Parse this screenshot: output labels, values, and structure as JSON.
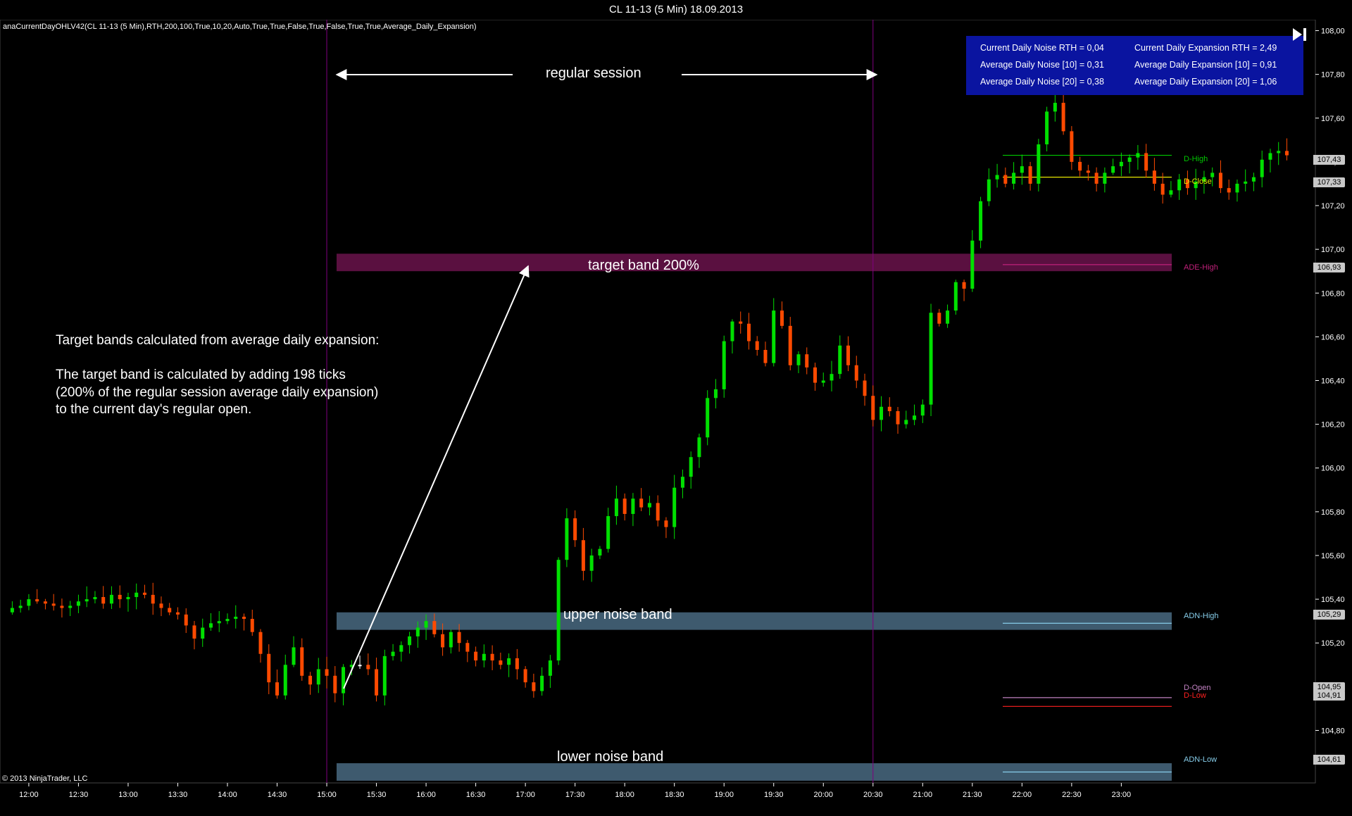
{
  "window": {
    "title": "CL 11-13 (5 Min)  18.09.2013"
  },
  "indicator_label": "anaCurrentDayOHLV42(CL 11-13 (5 Min),RTH,200,100,True,10,20,Auto,True,True,False,True,False,True,True,Average_Daily_Expansion)",
  "copyright": "© 2013 NinjaTrader, LLC",
  "info_box": {
    "current_noise": "Current Daily Noise RTH = 0,04",
    "avg_noise_10": "Average Daily Noise [10] = 0,31",
    "avg_noise_20": "Average Daily Noise [20] = 0,38",
    "current_expansion": "Current Daily Expansion RTH = 2,49",
    "avg_expansion_10": "Average Daily Expansion [10] = 0,91",
    "avg_expansion_20": "Average Daily Expansion [20] = 1,06"
  },
  "session_label": "regular session",
  "annotation": {
    "line1": "Target bands calculated from average daily expansion:",
    "line2": "The target band is calculated by adding 198 ticks",
    "line3": "(200% of the regular session average daily expansion)",
    "line4": "to the current day's regular open."
  },
  "bands": {
    "target": "target band 200%",
    "upper_noise": "upper noise band",
    "lower_noise": "lower noise band"
  },
  "series_labels": {
    "d_high": "D-High",
    "d_close": "D-Close",
    "ade_high": "ADE-High",
    "adn_high": "ADN-High",
    "d_open": "D-Open",
    "d_low": "D-Low",
    "adn_low": "ADN-Low"
  },
  "price_badges": {
    "d_high": "107,43",
    "d_close": "107,33",
    "ade_high": "106,93",
    "adn_high": "105,29",
    "d_open": "104,95",
    "d_low": "104,91",
    "adn_low": "104,61"
  },
  "colors": {
    "up_candle": "#00e000",
    "down_candle": "#ff4a00",
    "doji": "#ffffff",
    "target_band": "#5a1040",
    "noise_band": "#3e5a6e",
    "session_line": "#800080",
    "d_high": "#00c800",
    "d_close": "#e6e600",
    "ade_high": "#c0207a",
    "adn": "#87ceeb",
    "d_open": "#c080c0",
    "d_low": "#ff2020",
    "info_box": "#0a14a0"
  },
  "chart_data": {
    "type": "candlestick",
    "instrument": "CL 11-13",
    "interval": "5 Min",
    "date": "18.09.2013",
    "ylim": [
      104.56,
      108.05
    ],
    "y_ticks": [
      "108,00",
      "107,80",
      "107,60",
      "107,40",
      "107,20",
      "107,00",
      "106,80",
      "106,60",
      "106,40",
      "106,20",
      "106,00",
      "105,80",
      "105,60",
      "105,40",
      "105,20",
      "105,00",
      "104,80"
    ],
    "x_ticks": [
      "12:00",
      "12:30",
      "13:00",
      "13:30",
      "14:00",
      "14:30",
      "15:00",
      "15:30",
      "16:00",
      "16:30",
      "17:00",
      "17:30",
      "18:00",
      "18:30",
      "19:00",
      "19:30",
      "20:00",
      "20:30",
      "21:00",
      "21:30",
      "22:00",
      "22:30",
      "23:00"
    ],
    "session_start": "15:00",
    "session_end": "20:30",
    "levels": {
      "d_high": 107.43,
      "d_close": 107.33,
      "ade_high": 106.93,
      "adn_high": 105.29,
      "d_open": 104.95,
      "d_low": 104.91,
      "adn_low": 104.61
    },
    "bands": {
      "target": [
        106.9,
        106.98
      ],
      "upper_noise": [
        105.26,
        105.34
      ],
      "lower_noise": [
        104.57,
        104.65
      ]
    },
    "close_path": [
      105.36,
      105.37,
      105.4,
      105.39,
      105.38,
      105.37,
      105.36,
      105.37,
      105.39,
      105.4,
      105.41,
      105.38,
      105.42,
      105.4,
      105.41,
      105.43,
      105.42,
      105.38,
      105.36,
      105.34,
      105.33,
      105.28,
      105.22,
      105.27,
      105.29,
      105.3,
      105.31,
      105.32,
      105.31,
      105.25,
      105.15,
      105.02,
      104.96,
      105.1,
      105.18,
      105.05,
      105.01,
      105.08,
      105.05,
      104.97,
      105.09,
      105.1,
      105.1,
      105.08,
      104.96,
      105.14,
      105.16,
      105.19,
      105.23,
      105.27,
      105.3,
      105.24,
      105.18,
      105.25,
      105.2,
      105.16,
      105.12,
      105.15,
      105.12,
      105.1,
      105.13,
      105.08,
      105.02,
      104.98,
      105.05,
      105.12,
      105.58,
      105.77,
      105.67,
      105.53,
      105.6,
      105.63,
      105.78,
      105.86,
      105.79,
      105.86,
      105.82,
      105.84,
      105.76,
      105.73,
      105.91,
      105.96,
      106.05,
      106.14,
      106.32,
      106.36,
      106.58,
      106.67,
      106.66,
      106.58,
      106.54,
      106.48,
      106.72,
      106.65,
      106.47,
      106.52,
      106.46,
      106.39,
      106.4,
      106.43,
      106.56,
      106.47,
      106.4,
      106.33,
      106.22,
      106.28,
      106.26,
      106.2,
      106.22,
      106.24,
      106.29,
      106.71,
      106.66,
      106.72,
      106.85,
      106.82,
      107.04,
      107.22,
      107.32,
      107.34,
      107.3,
      107.35,
      107.38,
      107.3,
      107.48,
      107.63,
      107.67,
      107.54,
      107.4,
      107.36,
      107.35,
      107.3,
      107.35,
      107.38,
      107.4,
      107.42,
      107.44,
      107.36,
      107.3,
      107.25,
      107.27,
      107.32,
      107.28,
      107.31,
      107.33,
      107.35,
      107.28,
      107.26,
      107.3,
      107.31,
      107.33,
      107.41,
      107.44,
      107.45,
      107.43
    ]
  }
}
